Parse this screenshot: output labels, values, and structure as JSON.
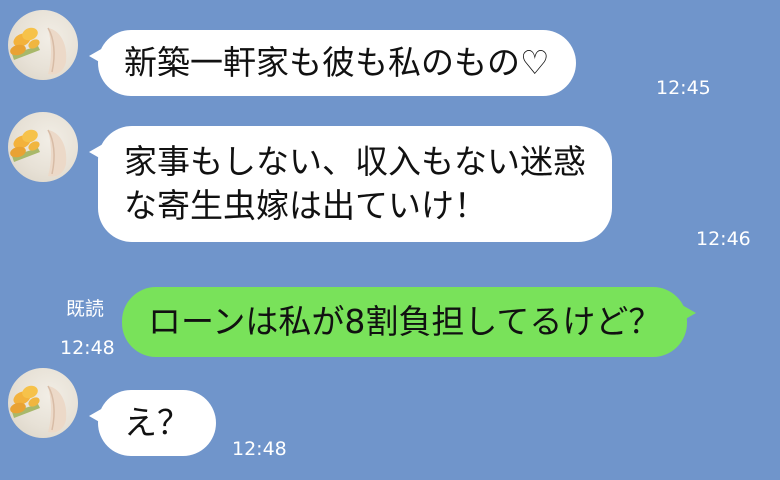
{
  "chat": {
    "messages": [
      {
        "side": "in",
        "text": "新築一軒家も彼も私のもの♡",
        "time": "12:45"
      },
      {
        "side": "in",
        "lines": [
          "家事もしない、収入もない迷惑",
          "な寄生虫嫁は出ていけ！"
        ],
        "time": "12:46"
      },
      {
        "side": "out",
        "text": "ローンは私が8割負担してるけど？",
        "time": "12:48",
        "read": "既読"
      },
      {
        "side": "in",
        "text": "え？",
        "time": "12:48"
      }
    ]
  },
  "colors": {
    "background": "#7095cb",
    "incoming_bubble": "#ffffff",
    "outgoing_bubble": "#79e25a"
  },
  "icons": {
    "avatar": "tulip-bouquet-avatar-icon"
  }
}
